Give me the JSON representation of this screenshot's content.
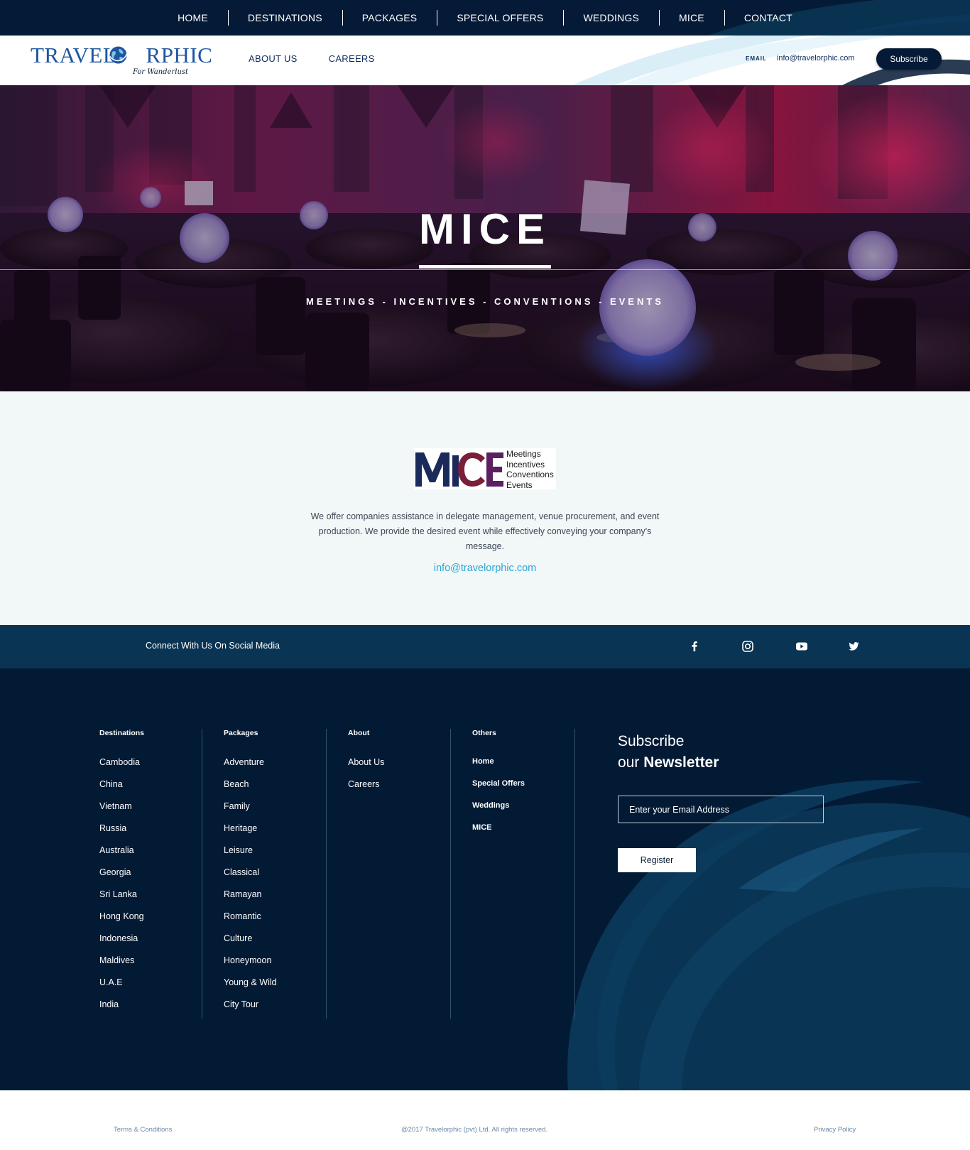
{
  "topnav": {
    "items": [
      "HOME",
      "DESTINATIONS",
      "PACKAGES",
      "SPECIAL OFFERS",
      "WEDDINGS",
      "MICE",
      "CONTACT"
    ]
  },
  "logo": {
    "brand": "TRAVELORPHIC",
    "tagline": "For Wanderlust"
  },
  "secondary_nav": {
    "about": "ABOUT US",
    "careers": "CAREERS"
  },
  "header_contact": {
    "email_label": "EMAIL",
    "email": "info@travelorphic.com",
    "subscribe_label": "Subscribe"
  },
  "hero": {
    "title": "MICE",
    "subtitle": "MEETINGS - INCENTIVES - CONVENTIONS - EVENTS"
  },
  "content": {
    "mice_logo": {
      "letters": "MICE",
      "words": [
        "Meetings",
        "Incentives",
        "Conventions",
        "Events"
      ]
    },
    "description": "We offer companies assistance in delegate management, venue procurement, and event production. We provide the desired event while effectively conveying your company's message.",
    "email": "info@travelorphic.com"
  },
  "social": {
    "label": "Connect With Us On Social Media",
    "icons": [
      "facebook-icon",
      "instagram-icon",
      "youtube-icon",
      "twitter-icon"
    ]
  },
  "footer": {
    "destinations": {
      "heading": "Destinations",
      "items": [
        "Cambodia",
        "China",
        "Vietnam",
        "Russia",
        "Australia",
        "Georgia",
        "Sri Lanka",
        "Hong Kong",
        "Indonesia",
        "Maldives",
        "U.A.E",
        "India"
      ]
    },
    "packages": {
      "heading": "Packages",
      "items": [
        "Adventure",
        "Beach",
        "Family",
        "Heritage",
        "Leisure",
        "Classical",
        "Ramayan",
        "Romantic",
        "Culture",
        "Honeymoon",
        "Young & Wild",
        "City Tour"
      ]
    },
    "about": {
      "heading": "About",
      "items": [
        "About Us",
        "Careers"
      ]
    },
    "others": {
      "heading": "Others",
      "items": [
        "Home",
        "Special Offers",
        "Weddings",
        "MICE"
      ]
    },
    "newsletter": {
      "line1": "Subscribe",
      "line2_prefix": "our",
      "line2_bold": "Newsletter",
      "email_placeholder": "Enter your Email Address",
      "button_label": "Register"
    }
  },
  "bottom": {
    "terms": "Terms & Conditions",
    "copyright": "@2017 Travelorphic (pvt) Ltd. All rights reserved.",
    "privacy": "Privacy Policy"
  },
  "colors": {
    "navy": "#041a36",
    "footer_bg": "#031a35",
    "social_bar": "#0a3453",
    "accent_link": "#2aa4d5",
    "brand_blue": "#1e56a0"
  }
}
